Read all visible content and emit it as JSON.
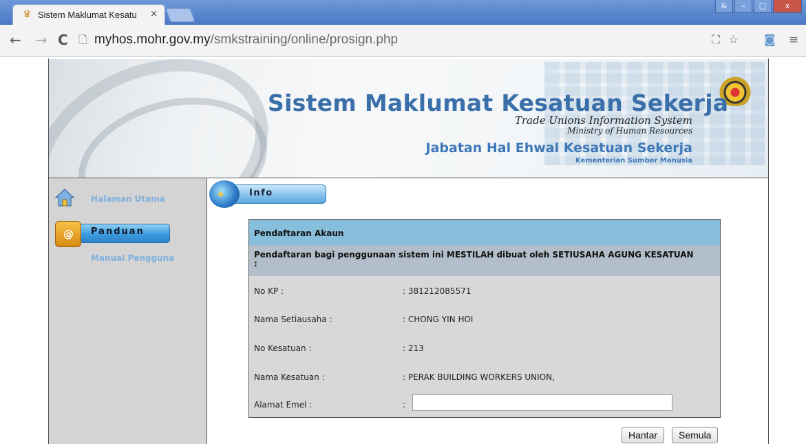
{
  "browser": {
    "tab_title": "Sistem Maklumat Kesatu",
    "tab_close": "×",
    "window_buttons": [
      "&",
      "–",
      "□",
      "x"
    ],
    "url_domain": "myhos.mohr.gov.my",
    "url_path": "/smkstraining/online/prosign.php"
  },
  "banner": {
    "title": "Sistem Maklumat Kesatuan Sekerja",
    "subtitle_en": "Trade Unions Information System",
    "ministry_en": "Ministry of Human Resources",
    "department": "Jabatan Hal Ehwal Kesatuan Sekerja",
    "ministry_ms": "Kementerian Sumber Manusia"
  },
  "sidebar": {
    "home_label": "Halaman Utama",
    "panduan_label": "Panduan",
    "manual_label": "Manual Pengguna"
  },
  "info": {
    "label": "Info"
  },
  "form": {
    "header": "Pendaftaran Akaun",
    "notice": "Pendaftaran bagi penggunaan sistem ini MESTILAH dibuat oleh SETIUSAHA AGUNG KESATUAN :",
    "rows": [
      {
        "label": "No KP :",
        "value": ": 381212085571"
      },
      {
        "label": "Nama Setiausaha :",
        "value": ": CHONG YIN HOI"
      },
      {
        "label": "No Kesatuan :",
        "value": ": 213"
      },
      {
        "label": "Nama Kesatuan :",
        "value": ": PERAK BUILDING WORKERS UNION,"
      }
    ],
    "email_label": "Alamat Emel :",
    "email_colon": ":",
    "email_value": "",
    "submit_label": "Hantar",
    "reset_label": "Semula"
  }
}
